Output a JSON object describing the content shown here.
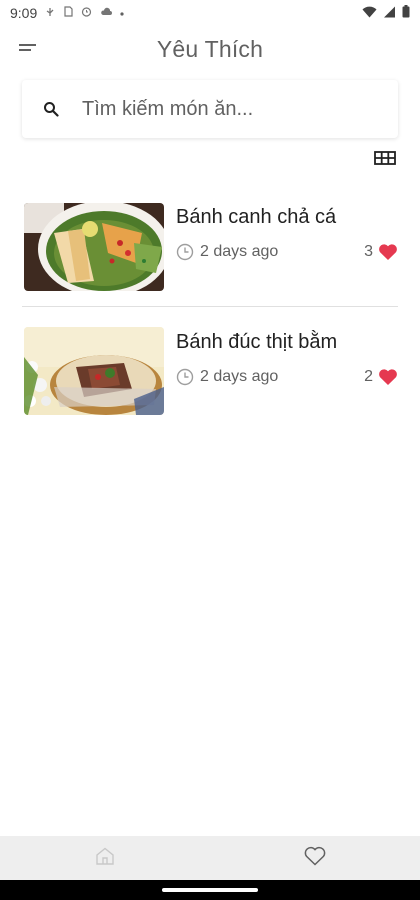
{
  "status_bar": {
    "time": "9:09",
    "left_icons": [
      "usb-icon",
      "sim-icon",
      "alarm-icon",
      "cloud-icon",
      "dot-icon"
    ],
    "right_icons": [
      "wifi-icon",
      "signal-icon",
      "battery-icon"
    ]
  },
  "header": {
    "title": "Yêu Thích",
    "menu_icon": "menu-icon"
  },
  "search": {
    "placeholder": "Tìm kiếm món ăn...",
    "value": ""
  },
  "toolbar": {
    "view_toggle_icon": "grid-view-icon"
  },
  "favorites": [
    {
      "name": "Bánh canh chả cá",
      "time": "2 days ago",
      "likes": "3",
      "image": "fish-noodle-soup"
    },
    {
      "name": "Bánh đúc thịt bằm",
      "time": "2 days ago",
      "likes": "2",
      "image": "rice-cake-minced-pork"
    }
  ],
  "bottom_nav": {
    "items": [
      {
        "icon": "home-icon",
        "active": false
      },
      {
        "icon": "heart-outline-icon",
        "active": true
      }
    ]
  },
  "colors": {
    "accent_heart": "#e53950",
    "title_text": "#616161",
    "nav_background": "#eeeeee"
  }
}
